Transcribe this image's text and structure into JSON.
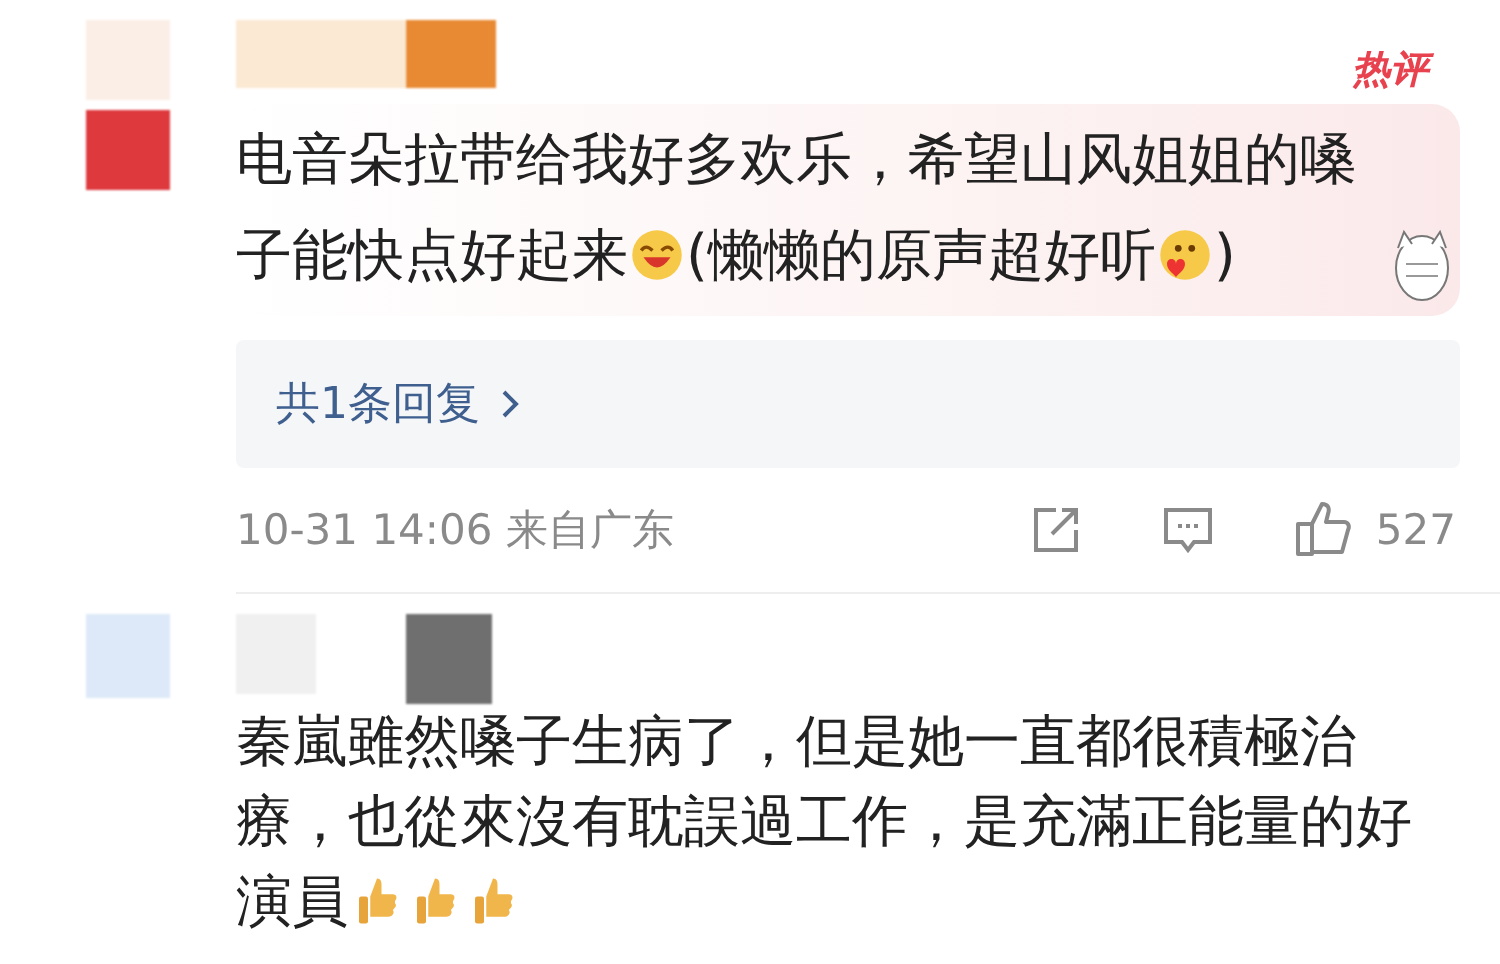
{
  "comments": [
    {
      "kind": "hot",
      "hot_badge": "热评",
      "segments": [
        {
          "kind": "text",
          "text": "电音朵拉带给我好多欢乐，希望山风姐姐的嗓子能快点好起来"
        },
        {
          "kind": "laugh-emoji"
        },
        {
          "kind": "text",
          "text": "(懒懒的原声超好听"
        },
        {
          "kind": "love-emoji"
        },
        {
          "kind": "text",
          "text": ")"
        }
      ],
      "reply_link": "共1条回复",
      "time": "10-31 14:06",
      "location": "来自广东",
      "likes": "527"
    },
    {
      "kind": "plain",
      "segments": [
        {
          "kind": "text",
          "text": "秦嵐雖然嗓子生病了，但是她一直都很積極治療，也從來沒有耽誤過工作，是充滿正能量的好演員"
        },
        {
          "kind": "thumbs-emoji"
        },
        {
          "kind": "thumbs-emoji"
        },
        {
          "kind": "thumbs-emoji"
        }
      ]
    }
  ]
}
